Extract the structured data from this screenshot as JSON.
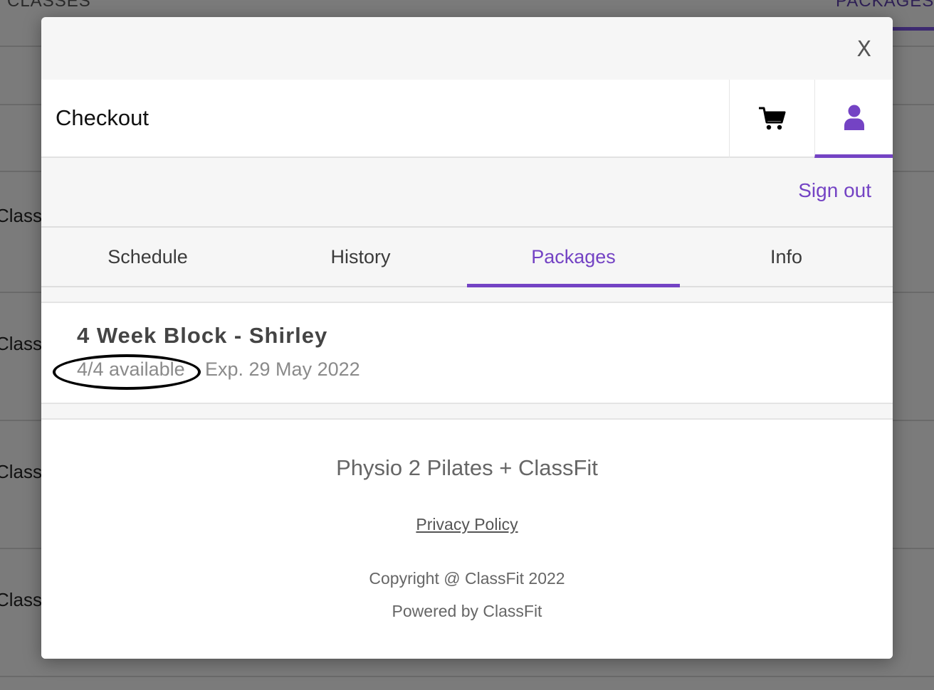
{
  "background": {
    "tabs": [
      "CLASSES",
      "PACKAGES"
    ],
    "row_label": "Class"
  },
  "modal": {
    "close_label": "X",
    "header": {
      "title": "Checkout",
      "cart_icon": "shopping-cart-icon",
      "account_icon": "user-icon"
    },
    "sign_out": "Sign out",
    "tabs": [
      {
        "label": "Schedule",
        "active": false
      },
      {
        "label": "History",
        "active": false
      },
      {
        "label": "Packages",
        "active": true
      },
      {
        "label": "Info",
        "active": false
      }
    ],
    "package": {
      "title": "4 Week Block - Shirley",
      "availability": "4/4 available",
      "expiry": "Exp. 29 May 2022"
    },
    "footer": {
      "brand": "Physio 2 Pilates + ClassFit",
      "privacy_link": "Privacy Policy",
      "copyright": "Copyright @ ClassFit 2022",
      "powered_by": "Powered by ClassFit"
    }
  },
  "colors": {
    "accent": "#7443c4",
    "overlay": "#7b7b7b"
  }
}
